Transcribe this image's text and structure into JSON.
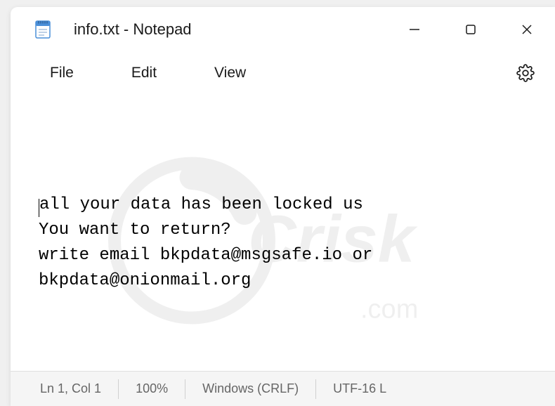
{
  "window": {
    "title": "info.txt - Notepad"
  },
  "menu": {
    "file": "File",
    "edit": "Edit",
    "view": "View"
  },
  "editor": {
    "content": "all your data has been locked us\nYou want to return?\nwrite email bkpdata@msgsafe.io or bkpdata@onionmail.org"
  },
  "statusbar": {
    "position": "Ln 1, Col 1",
    "zoom": "100%",
    "lineending": "Windows (CRLF)",
    "encoding": "UTF-16 L"
  }
}
